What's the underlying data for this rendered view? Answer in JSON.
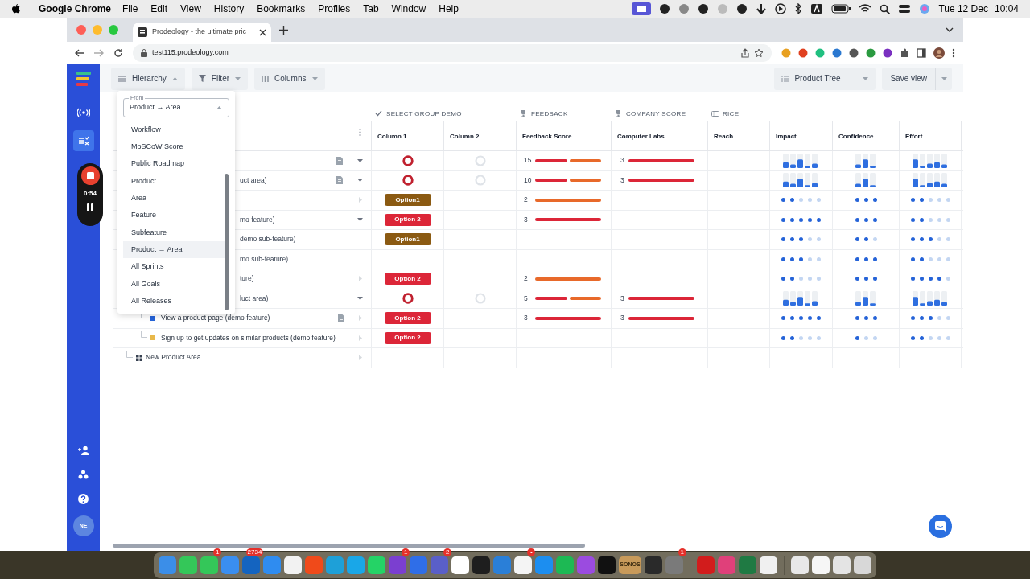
{
  "menubar": {
    "app": "Google Chrome",
    "menus": [
      "File",
      "Edit",
      "View",
      "History",
      "Bookmarks",
      "Profiles",
      "Tab",
      "Window",
      "Help"
    ],
    "date": "Tue 12 Dec",
    "time": "10:04"
  },
  "browser": {
    "tab_title": "Prodeology - the ultimate pric",
    "url": "test115.prodeology.com"
  },
  "recorder": {
    "time": "0:54"
  },
  "sidebar": {
    "avatar": "NE"
  },
  "toolbar": {
    "hierarchy": "Hierarchy",
    "filter": "Filter",
    "columns": "Columns",
    "view": "Product Tree",
    "save": "Save view"
  },
  "hierarchy_menu": {
    "label": "From",
    "value": "Product → Area",
    "options": [
      {
        "label": "Workflow",
        "selected": false
      },
      {
        "label": "MoSCoW Score",
        "selected": false
      },
      {
        "label": "Public Roadmap",
        "selected": false
      },
      {
        "label": "Product",
        "selected": false
      },
      {
        "label": "Area",
        "selected": false
      },
      {
        "label": "Feature",
        "selected": false
      },
      {
        "label": "Subfeature",
        "selected": false
      },
      {
        "label": "Product → Area",
        "selected": true
      },
      {
        "label": "All Sprints",
        "selected": false
      },
      {
        "label": "All Goals",
        "selected": false
      },
      {
        "label": "All Releases",
        "selected": false
      }
    ]
  },
  "table": {
    "groups": [
      {
        "title": "SELECT GROUP DEMO",
        "columns": [
          "Column 1",
          "Column 2"
        ]
      },
      {
        "title": "FEEDBACK",
        "columns": [
          "Feedback Score"
        ]
      },
      {
        "title": "COMPANY SCORE",
        "columns": [
          "Computer Labs"
        ]
      },
      {
        "title": "RICE",
        "columns": [
          "Reach",
          "Impact",
          "Confidence",
          "Effort"
        ]
      }
    ],
    "rows": [
      {
        "kind": "partial",
        "expanded": true,
        "doc": true,
        "col1": {
          "kind": "ring"
        },
        "col2": {
          "kind": "ring"
        },
        "feedback": {
          "value": "15",
          "segments": [
            {
              "color": "#dc2638"
            },
            {
              "color": "#e8692a"
            }
          ]
        },
        "company": {
          "value": "3"
        },
        "rice": [
          {
            "kind": "bars"
          },
          {
            "kind": "bars"
          },
          {
            "kind": "bars"
          }
        ]
      },
      {
        "kind": "partial",
        "label": "uct area)",
        "expanded": true,
        "doc": true,
        "col1": {
          "kind": "ring"
        },
        "col2": {
          "kind": "ring"
        },
        "feedback": {
          "value": "10",
          "segments": [
            {
              "color": "#dc2638"
            },
            {
              "color": "#e8692a"
            }
          ]
        },
        "company": {
          "value": "3"
        },
        "rice": [
          {
            "kind": "bars"
          },
          {
            "kind": "bars"
          },
          {
            "kind": "bars"
          }
        ]
      },
      {
        "kind": "partial",
        "expanded": false,
        "col1": {
          "kind": "option",
          "text": "Option1",
          "color": "#8b5a12"
        },
        "feedback": {
          "value": "2",
          "segments": [
            {
              "color": "#e8692a"
            }
          ]
        },
        "rice": [
          {
            "kind": "dots",
            "stars": 2
          },
          {
            "kind": "dots",
            "stars": 3
          },
          {
            "kind": "dots",
            "stars": 2
          }
        ]
      },
      {
        "kind": "partial",
        "label": "mo feature)",
        "expanded": true,
        "col1": {
          "kind": "option",
          "text": "Option 2",
          "color": "#dc2638"
        },
        "feedback": {
          "value": "3",
          "segments": [
            {
              "color": "#dc2638"
            }
          ]
        },
        "rice": [
          {
            "kind": "dots",
            "stars": 5
          },
          {
            "kind": "dots",
            "stars": 3
          },
          {
            "kind": "dots",
            "stars": 2
          }
        ]
      },
      {
        "kind": "partial",
        "label": "demo sub-feature)",
        "col1": {
          "kind": "option",
          "text": "Option1",
          "color": "#8b5a12"
        },
        "rice": [
          {
            "kind": "dots",
            "stars": 3
          },
          {
            "kind": "dots",
            "stars": 2
          },
          {
            "kind": "dots",
            "stars": 3
          }
        ]
      },
      {
        "kind": "partial",
        "label": "mo sub-feature)",
        "rice": [
          {
            "kind": "dots",
            "stars": 3
          },
          {
            "kind": "dots",
            "stars": 3
          },
          {
            "kind": "dots",
            "stars": 2
          }
        ]
      },
      {
        "kind": "partial",
        "label": "ture)",
        "expanded": false,
        "col1": {
          "kind": "option",
          "text": "Option 2",
          "color": "#dc2638"
        },
        "feedback": {
          "value": "2",
          "segments": [
            {
              "color": "#e8692a"
            }
          ]
        },
        "rice": [
          {
            "kind": "dots",
            "stars": 2
          },
          {
            "kind": "dots",
            "stars": 3
          },
          {
            "kind": "dots",
            "stars": 4
          }
        ]
      },
      {
        "kind": "partial",
        "label": "luct area)",
        "expanded": true,
        "col1": {
          "kind": "ring"
        },
        "col2": {
          "kind": "ring"
        },
        "feedback": {
          "value": "5",
          "segments": [
            {
              "color": "#dc2638"
            },
            {
              "color": "#e8692a"
            }
          ]
        },
        "company": {
          "value": "3"
        },
        "rice": [
          {
            "kind": "bars"
          },
          {
            "kind": "bars"
          },
          {
            "kind": "bars"
          }
        ],
        "children": [
          {
            "kind": "feature",
            "label": "View a product page (demo feature)",
            "color": "#2563d8",
            "expanded": false,
            "doc": true,
            "col1": {
              "kind": "option",
              "text": "Option 2",
              "color": "#dc2638"
            },
            "feedback": {
              "value": "3",
              "segments": [
                {
                  "color": "#dc2638"
                }
              ]
            },
            "company": {
              "value": "3"
            },
            "rice": [
              {
                "kind": "dots",
                "stars": 5
              },
              {
                "kind": "dots",
                "stars": 3
              },
              {
                "kind": "dots",
                "stars": 3
              }
            ]
          },
          {
            "kind": "feature",
            "label": "Sign up to get updates on similar products (demo feature)",
            "color": "#e8b84a",
            "expanded": false,
            "col1": {
              "kind": "option",
              "text": "Option 2",
              "color": "#dc2638"
            },
            "rice": [
              {
                "kind": "dots",
                "stars": 2
              },
              {
                "kind": "dots",
                "stars": 1
              },
              {
                "kind": "dots",
                "stars": 2
              }
            ]
          }
        ]
      },
      {
        "kind": "area",
        "label": "New Product Area",
        "expanded": false
      }
    ]
  },
  "dock": [
    {
      "color": "#3b8ee8"
    },
    {
      "color": "#34c759"
    },
    {
      "color": "#34c759",
      "badge": "1"
    },
    {
      "color": "#3a8ef0"
    },
    {
      "color": "#1464c0",
      "badge": "2734"
    },
    {
      "color": "#2f8cf0"
    },
    {
      "color": "#f2f2f2"
    },
    {
      "color": "#f04a1a"
    },
    {
      "color": "#1ea0d8"
    },
    {
      "color": "#19a7e8"
    },
    {
      "color": "#25d366"
    },
    {
      "color": "#7b3fd0",
      "badge": "1"
    },
    {
      "color": "#2f6ee8"
    },
    {
      "color": "#5a5fc8",
      "badge": "2"
    },
    {
      "color": "#ffffff"
    },
    {
      "color": "#1e1e1e"
    },
    {
      "color": "#2a7fd8"
    },
    {
      "color": "#f4f4f4",
      "badge": "•"
    },
    {
      "color": "#1c8ef0"
    },
    {
      "color": "#1db954"
    },
    {
      "color": "#9b4be0"
    },
    {
      "color": "#111111"
    },
    {
      "color": "#c89a5a",
      "label": "SONOS"
    },
    {
      "color": "#2a2a2a"
    },
    {
      "color": "#7a7a7a",
      "badge": "1"
    },
    {
      "color": "#d21c1c"
    },
    {
      "color": "#e0407a"
    },
    {
      "color": "#1f7a43"
    },
    {
      "color": "#f0f0f0"
    },
    {
      "color": "#e8e8e8"
    },
    {
      "color": "#f6f6f6"
    },
    {
      "color": "#e4e4e4"
    },
    {
      "color": "#d8d8d8"
    }
  ]
}
